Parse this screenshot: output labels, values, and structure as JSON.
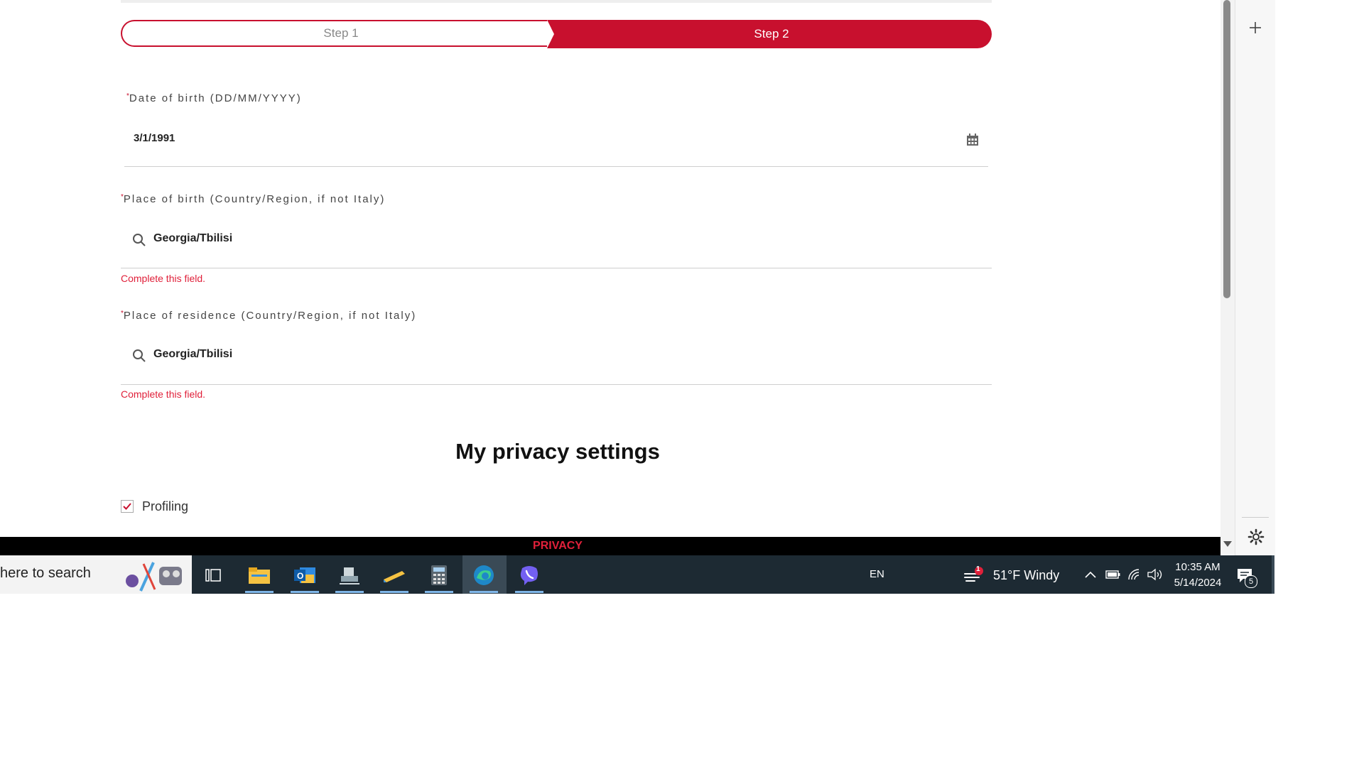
{
  "stepper": {
    "step1_label": "Step 1",
    "step2_label": "Step 2",
    "active_step": 2,
    "accent_color": "#c8102e"
  },
  "form": {
    "required_mark": "*",
    "dob": {
      "label": "Date of birth (DD/MM/YYYY)",
      "value": "3/1/1991"
    },
    "birthplace": {
      "label": "Place of birth (Country/Region, if not Italy)",
      "value": "Georgia/Tbilisi",
      "error": "Complete this field."
    },
    "residence": {
      "label": "Place of residence (Country/Region, if not Italy)",
      "value": "Georgia/Tbilisi",
      "error": "Complete this field."
    }
  },
  "privacy": {
    "title": "My privacy settings",
    "profiling_label": "Profiling",
    "profiling_checked": true
  },
  "privacy_bar": {
    "label": "PRIVACY"
  },
  "side_panel": {
    "add_icon": "plus-icon",
    "settings_icon": "gear-icon"
  },
  "taskbar": {
    "search_placeholder": "here to search",
    "apps": [
      "task-view-icon",
      "file-explorer-icon",
      "outlook-icon",
      "network-app-icon",
      "pen-app-icon",
      "calculator-icon",
      "edge-icon",
      "viber-icon"
    ],
    "language": "EN",
    "weather": "51°F  Windy",
    "weather_badge": "1",
    "time": "10:35 AM",
    "date": "5/14/2024",
    "notifications": "5"
  }
}
